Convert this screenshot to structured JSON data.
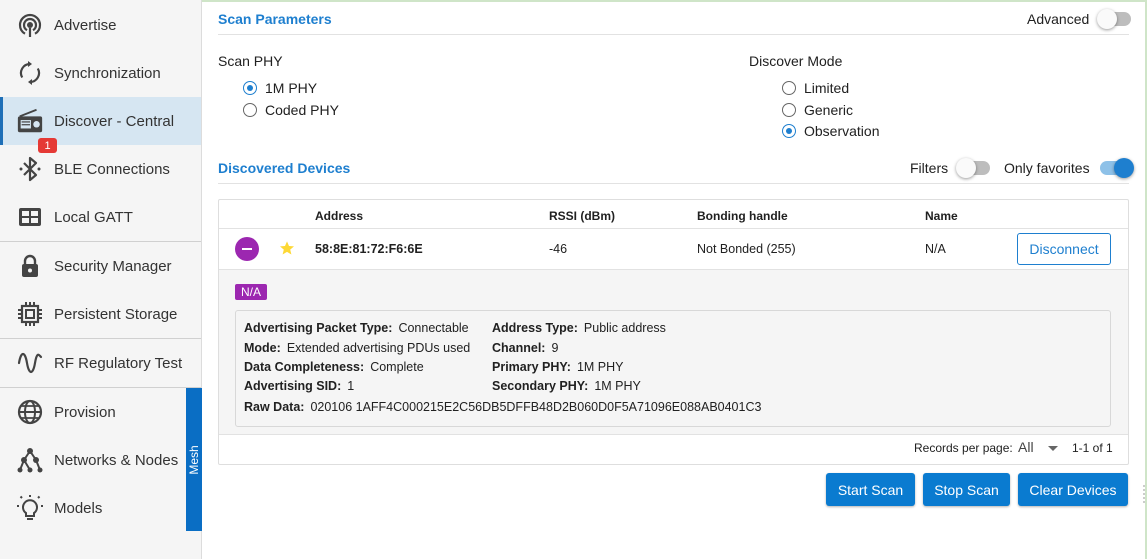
{
  "sidebar": {
    "items": [
      {
        "label": "Advertise",
        "icon": "advertise-icon"
      },
      {
        "label": "Synchronization",
        "icon": "sync-icon"
      },
      {
        "label": "Discover - Central",
        "icon": "radio-icon",
        "active": true
      },
      {
        "label": "BLE Connections",
        "icon": "bluetooth-icon",
        "badge": "1"
      },
      {
        "label": "Local GATT",
        "icon": "table-icon"
      },
      {
        "label": "Security Manager",
        "icon": "lock-icon"
      },
      {
        "label": "Persistent Storage",
        "icon": "chip-icon"
      },
      {
        "label": "RF Regulatory Test",
        "icon": "sine-wave-icon"
      },
      {
        "label": "Provision",
        "icon": "globe-icon"
      },
      {
        "label": "Networks & Nodes",
        "icon": "network-icon"
      },
      {
        "label": "Models",
        "icon": "lightbulb-icon"
      }
    ],
    "mesh_tab_label": "Mesh"
  },
  "scan_params": {
    "title": "Scan Parameters",
    "advanced_label": "Advanced",
    "advanced_on": false,
    "scan_phy_label": "Scan PHY",
    "scan_phy_options": [
      "1M PHY",
      "Coded PHY"
    ],
    "scan_phy_selected": "1M PHY",
    "discover_mode_label": "Discover Mode",
    "discover_mode_options": [
      "Limited",
      "Generic",
      "Observation"
    ],
    "discover_mode_selected": "Observation"
  },
  "discovered": {
    "title": "Discovered Devices",
    "filters_label": "Filters",
    "filters_on": false,
    "only_favorites_label": "Only favorites",
    "only_favorites_on": true,
    "columns": [
      "Address",
      "RSSI (dBm)",
      "Bonding handle",
      "Name"
    ],
    "rows": [
      {
        "address": "58:8E:81:72:F6:6E",
        "rssi": "-46",
        "bonding": "Not Bonded (255)",
        "name": "N/A",
        "favorite": true,
        "action_label": "Disconnect",
        "chip": "N/A",
        "details": {
          "adv_packet_type_label": "Advertising Packet Type:",
          "adv_packet_type": "Connectable",
          "mode_label": "Mode:",
          "mode": "Extended advertising PDUs used",
          "data_completeness_label": "Data Completeness:",
          "data_completeness": "Complete",
          "adv_sid_label": "Advertising SID:",
          "adv_sid": "1",
          "raw_data_label": "Raw Data:",
          "raw_data": "020106 1AFF4C000215E2C56DB5DFFB48D2B060D0F5A71096E088AB0401C3",
          "address_type_label": "Address Type:",
          "address_type": "Public address",
          "channel_label": "Channel:",
          "channel": "9",
          "primary_phy_label": "Primary PHY:",
          "primary_phy": "1M PHY",
          "secondary_phy_label": "Secondary PHY:",
          "secondary_phy": "1M PHY"
        }
      }
    ],
    "records_per_page_label": "Records per page:",
    "records_per_page_value": "All",
    "range_text": "1-1 of 1"
  },
  "actions": {
    "start_scan": "Start Scan",
    "stop_scan": "Stop Scan",
    "clear_devices": "Clear Devices"
  },
  "colors": {
    "accent": "#1e7fcf",
    "button": "#0a7bd0",
    "purple": "#9c27b0",
    "badge": "#e53935",
    "active_nav": "#d6e6f2"
  }
}
